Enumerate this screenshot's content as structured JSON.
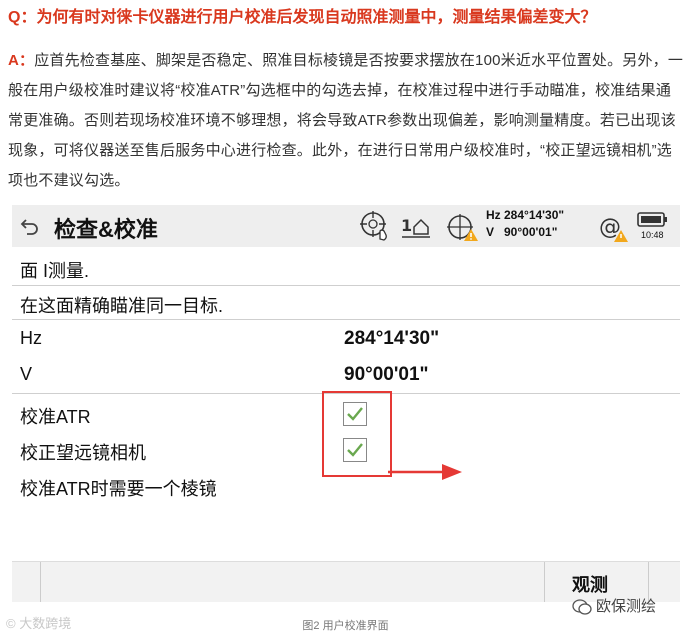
{
  "qa": {
    "question": "Q：为何有时对徕卡仪器进行用户校准后发现自动照准测量中，测量结果偏差变大？",
    "answer_label": "A：",
    "answer": "应首先检查基座、脚架是否稳定、照准目标棱镜是否按要求摆放在100米近水平位置处。另外，一般在用户级校准时建议将“校准ATR”勾选框中的勾选去掉，在校准过程中进行手动瞄准，校准结果通常更准确。否则若现场校准环境不够理想，将会导致ATR参数出现偏差，影响测量精度。若已出现该现象，可将仪器送至售后服务中心进行检查。此外，在进行日常用户级校准时，“校正望远镜相机”选项也不建议勾选。"
  },
  "device": {
    "title": "检查&校准",
    "status": {
      "hz_v_text": "Hz 284°14'30\"\nV   90°00'01\"",
      "face_indicator": "1",
      "time": "10:48"
    },
    "face_line": "面 I测量.",
    "instruction": "在这面精确瞄准同一目标.",
    "hz": {
      "label": "Hz",
      "value": "284°14'30\""
    },
    "v": {
      "label": "V",
      "value": "90°00'01\""
    },
    "options": [
      {
        "label": "校准ATR",
        "checked": true
      },
      {
        "label": "校正望远镜相机",
        "checked": true
      }
    ],
    "note": "校准ATR时需要一个棱镜",
    "softkey": "观测",
    "colors": {
      "highlight": "#e53935",
      "check": "#6aa84f",
      "question": "#d9381e"
    }
  },
  "caption": "图2 用户校准界面",
  "watermark_left": "大数跨境",
  "watermark_right": "欧保测绘"
}
